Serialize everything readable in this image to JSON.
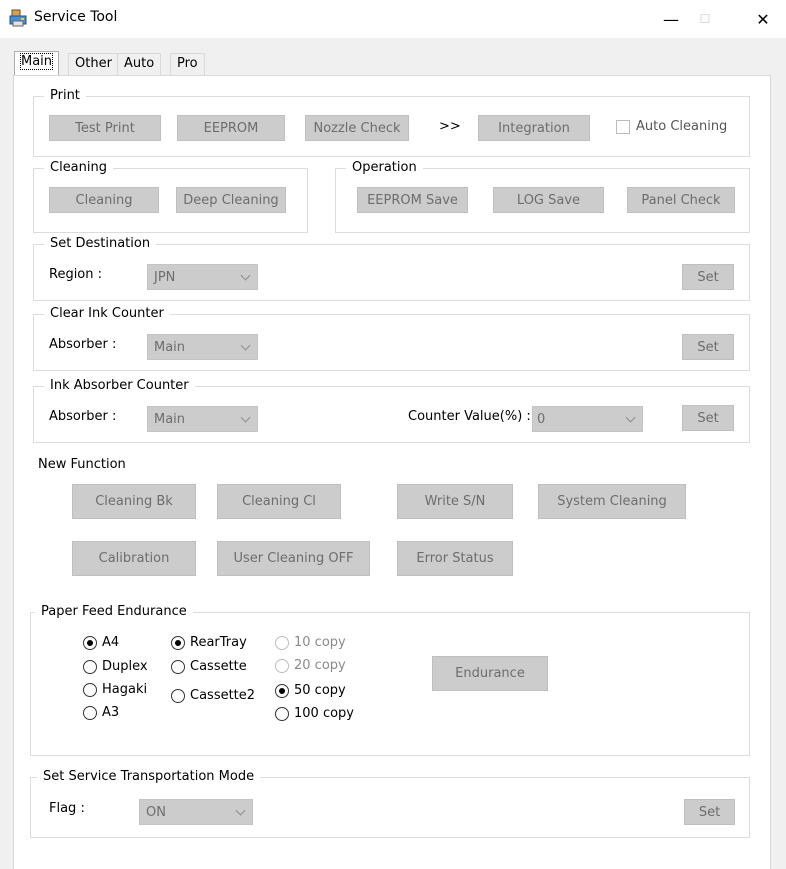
{
  "window": {
    "title": "Service Tool",
    "minimize": "—",
    "maximize": "☐",
    "close": "✕"
  },
  "tabs": [
    "Main",
    "Other",
    "Auto",
    "Pro"
  ],
  "print": {
    "title": "Print",
    "test_print": "Test Print",
    "eeprom": "EEPROM",
    "nozzle_check": "Nozzle Check",
    "arrows": ">>",
    "integration": "Integration",
    "auto_cleaning": "Auto Cleaning"
  },
  "cleaning": {
    "title": "Cleaning",
    "cleaning": "Cleaning",
    "deep_cleaning": "Deep Cleaning"
  },
  "operation": {
    "title": "Operation",
    "eeprom_save": "EEPROM Save",
    "log_save": "LOG Save",
    "panel_check": "Panel Check"
  },
  "set_destination": {
    "title": "Set Destination",
    "region_label": "Region :",
    "region_value": "JPN",
    "set": "Set"
  },
  "clear_ink_counter": {
    "title": "Clear Ink Counter",
    "absorber_label": "Absorber :",
    "absorber_value": "Main",
    "set": "Set"
  },
  "ink_absorber_counter": {
    "title": "Ink Absorber Counter",
    "absorber_label": "Absorber :",
    "absorber_value": "Main",
    "counter_label": "Counter Value(%) :",
    "counter_value": "0",
    "set": "Set"
  },
  "new_function": {
    "title": "New Function",
    "cleaning_bk": "Cleaning Bk",
    "cleaning_cl": "Cleaning Cl",
    "write_sn": "Write S/N",
    "system_cleaning": "System Cleaning",
    "calibration": "Calibration",
    "user_cleaning_off": "User Cleaning OFF",
    "error_status": "Error Status"
  },
  "paper_feed": {
    "title": "Paper Feed Endurance",
    "size": [
      "A4",
      "Duplex",
      "Hagaki",
      "A3"
    ],
    "source": [
      "RearTray",
      "Cassette",
      "Cassette2"
    ],
    "copies": [
      "10 copy",
      "20 copy",
      "50 copy",
      "100 copy"
    ],
    "endurance": "Endurance"
  },
  "transport": {
    "title": "Set Service Transportation Mode",
    "flag_label": "Flag :",
    "flag_value": "ON",
    "set": "Set"
  },
  "colors": {
    "button_disabled_bg": "#cccccc",
    "button_disabled_text": "#6d6d6d",
    "panel_bg": "#ffffff",
    "window_bg": "#f0f0f0"
  }
}
